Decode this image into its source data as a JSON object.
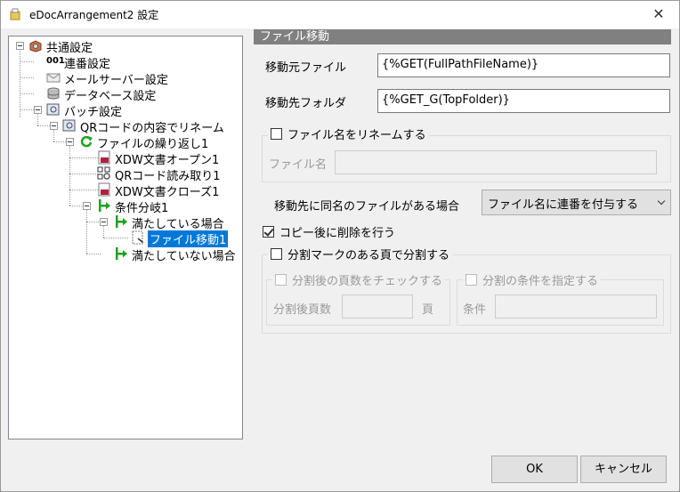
{
  "window": {
    "title": "eDocArrangement2 設定",
    "close_glyph": "✕"
  },
  "tree": {
    "common": "共通設定",
    "serial": "連番設定",
    "serial_icon_text": "001",
    "mail": "メールサーバー設定",
    "database": "データベース設定",
    "batch": "バッチ設定",
    "qr_rename": "QRコードの内容でリネーム",
    "loop": "ファイルの繰り返し1",
    "xdw_open": "XDW文書オープン1",
    "qr_read": "QRコード読み取り1",
    "xdw_close": "XDW文書クローズ1",
    "branch": "条件分岐1",
    "satisfied": "満たしている場合",
    "file_move": "ファイル移動1",
    "not_satisfied": "満たしていない場合"
  },
  "panel": {
    "header": "ファイル移動",
    "source_label": "移動元ファイル",
    "source_value": "{%GET(FullPathFileName)}",
    "dest_label": "移動先フォルダ",
    "dest_value": "{%GET_G(TopFolder)}",
    "rename_checkbox": "ファイル名をリネームする",
    "filename_label": "ファイル名",
    "filename_value": "",
    "same_name_label": "移動先に同名のファイルがある場合",
    "same_name_option": "ファイル名に連番を付与する",
    "delete_after_copy": "コピー後に削除を行う",
    "split_mark": "分割マークのある頁で分割する",
    "check_pages": "分割後の頁数をチェックする",
    "pages_label": "分割後頁数",
    "pages_value": "",
    "pages_unit": "頁",
    "specify_condition": "分割の条件を指定する",
    "condition_label": "条件",
    "condition_value": ""
  },
  "buttons": {
    "ok": "OK",
    "cancel": "キャンセル"
  },
  "colors": {
    "selection": "#0078d7",
    "header_bar": "#808080",
    "arrow_green": "#1ea21e"
  }
}
